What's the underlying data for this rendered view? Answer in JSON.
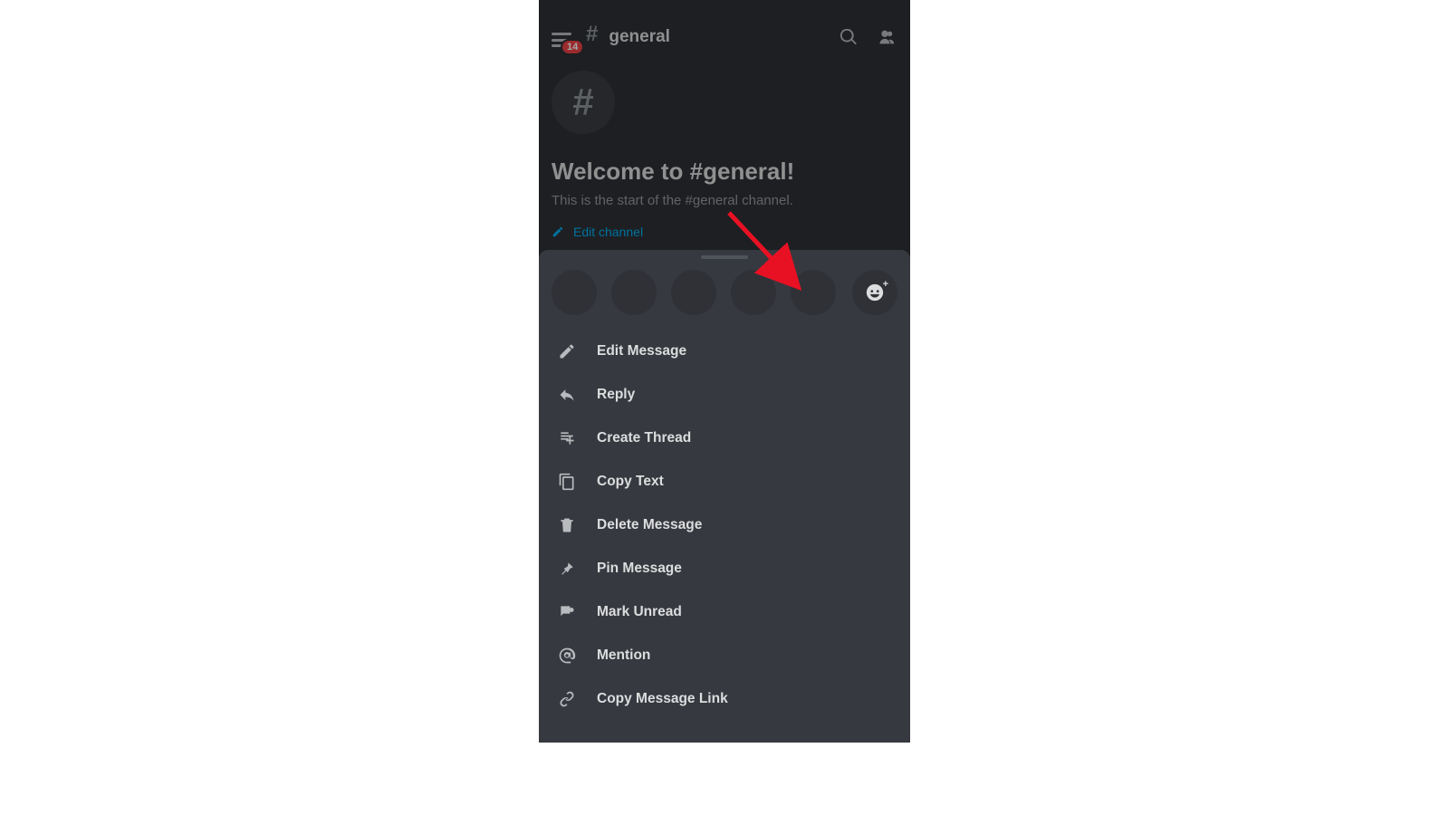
{
  "header": {
    "badge_count": "14",
    "channel_name": "general"
  },
  "welcome": {
    "title": "Welcome to #general!",
    "subtitle": "This is the start of the #general channel.",
    "edit_label": "Edit channel"
  },
  "menu": {
    "items": [
      {
        "id": "edit-message",
        "label": "Edit Message"
      },
      {
        "id": "reply",
        "label": "Reply"
      },
      {
        "id": "create-thread",
        "label": "Create Thread"
      },
      {
        "id": "copy-text",
        "label": "Copy Text"
      },
      {
        "id": "delete-message",
        "label": "Delete Message"
      },
      {
        "id": "pin-message",
        "label": "Pin Message"
      },
      {
        "id": "mark-unread",
        "label": "Mark Unread"
      },
      {
        "id": "mention",
        "label": "Mention"
      },
      {
        "id": "copy-link",
        "label": "Copy Message Link"
      }
    ]
  }
}
